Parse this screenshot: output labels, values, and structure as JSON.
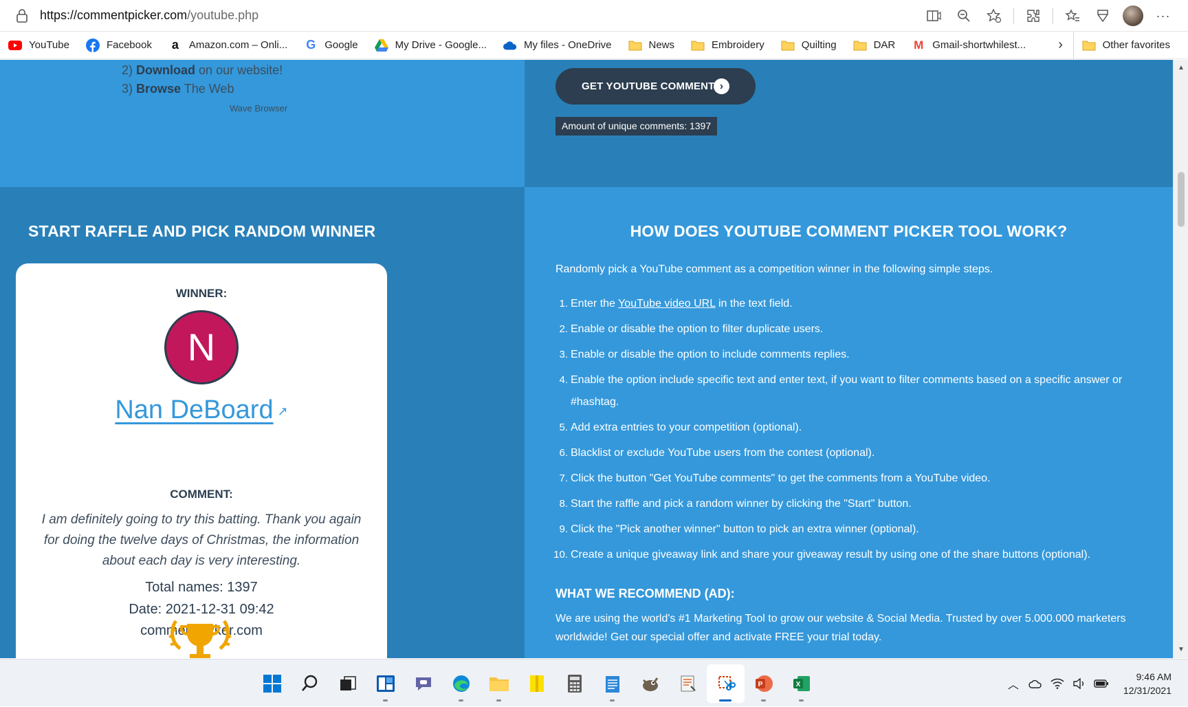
{
  "browser": {
    "url_host": "https://commentpicker.com",
    "url_path": "/youtube.php"
  },
  "favorites": [
    {
      "label": "YouTube",
      "icon": "youtube-icon"
    },
    {
      "label": "Facebook",
      "icon": "facebook-icon"
    },
    {
      "label": "Amazon.com – Onli...",
      "icon": "amazon-icon"
    },
    {
      "label": "Google",
      "icon": "google-icon"
    },
    {
      "label": "My Drive - Google...",
      "icon": "google-drive-icon"
    },
    {
      "label": "My files - OneDrive",
      "icon": "onedrive-icon"
    },
    {
      "label": "News",
      "icon": "folder-icon"
    },
    {
      "label": "Embroidery",
      "icon": "folder-icon"
    },
    {
      "label": "Quilting",
      "icon": "folder-icon"
    },
    {
      "label": "DAR",
      "icon": "folder-icon"
    },
    {
      "label": "Gmail-shortwhilest...",
      "icon": "gmail-icon"
    }
  ],
  "other_favorites": "Other favorites",
  "top_left": {
    "step2_num": "2)",
    "step2_bold": "Download",
    "step2_rest": "on our website!",
    "step3_num": "3)",
    "step3_bold": "Browse",
    "step3_rest": "The Web",
    "wave": "Wave Browser"
  },
  "top_right": {
    "get_button": "GET YOUTUBE COMMENTS",
    "unique_label": "Amount of unique comments: 1397"
  },
  "raffle": {
    "title": "START RAFFLE AND PICK RANDOM WINNER",
    "winner_label": "WINNER:",
    "avatar_letter": "N",
    "winner_name": "Nan DeBoard",
    "comment_label": "COMMENT:",
    "comment": "I am definitely going to try this batting. Thank you again for doing the twelve days of Christmas, the information about each day is very interesting.",
    "total_names": "Total names: 1397",
    "date": "Date: 2021-12-31 09:42",
    "site": "commentpicker.com"
  },
  "how": {
    "title": "HOW DOES YOUTUBE COMMENT PICKER TOOL WORK?",
    "intro": "Randomly pick a YouTube comment as a competition winner in the following simple steps.",
    "step1_a": "Enter the ",
    "step1_link": "YouTube video URL",
    "step1_b": " in the text field.",
    "steps": [
      "Enable or disable the option to filter duplicate users.",
      "Enable or disable the option to include comments replies.",
      "Enable the option include specific text and enter text, if you want to filter comments based on a specific answer or #hashtag.",
      "Add extra entries to your competition (optional).",
      "Blacklist or exclude YouTube users from the contest (optional).",
      "Click the button \"Get YouTube comments\" to get the comments from a YouTube video.",
      "Start the raffle and pick a random winner by clicking the \"Start\" button.",
      "Click the \"Pick another winner\" button to pick an extra winner (optional).",
      "Create a unique giveaway link and share your giveaway result by using one of the share buttons (optional)."
    ],
    "rec_title": "WHAT WE RECOMMEND (AD):",
    "rec_text": "We are using the world's #1 Marketing Tool to grow our website & Social Media. Trusted by over 5.000.000 marketers worldwide! Get our special offer and activate FREE your trial today."
  },
  "taskbar": {
    "time": "9:46 AM",
    "date": "12/31/2021"
  },
  "colors": {
    "light_blue": "#3498db",
    "dark_blue": "#2980b9",
    "navy": "#2c3e50",
    "avatar": "#c2185b"
  }
}
